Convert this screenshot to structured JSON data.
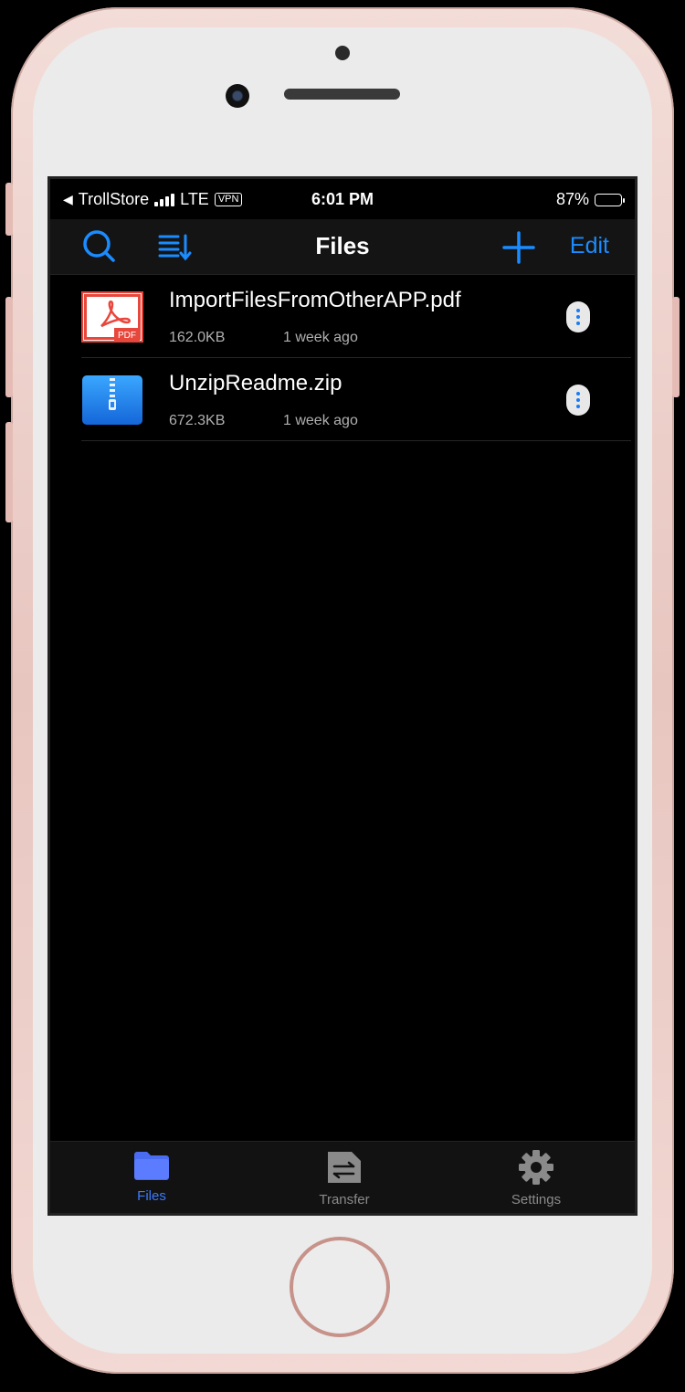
{
  "status_bar": {
    "back_app": "TrollStore",
    "network": "LTE",
    "vpn": "VPN",
    "time": "6:01 PM",
    "battery_percent": "87%",
    "battery_level": 0.87
  },
  "nav": {
    "title": "Files",
    "edit_label": "Edit",
    "icons": [
      "search-icon",
      "sort-icon",
      "plus-icon"
    ],
    "accent_color": "#1a8cff"
  },
  "files": [
    {
      "name": "ImportFilesFromOtherAPP.pdf",
      "size": "162.0KB",
      "modified": "1 week ago",
      "icon": "pdf-icon",
      "badge": "PDF"
    },
    {
      "name": "UnzipReadme.zip",
      "size": "672.3KB",
      "modified": "1 week ago",
      "icon": "zip-icon"
    }
  ],
  "tabs": [
    {
      "label": "Files",
      "icon": "folder-icon",
      "active": true
    },
    {
      "label": "Transfer",
      "icon": "transfer-icon",
      "active": false
    },
    {
      "label": "Settings",
      "icon": "gear-icon",
      "active": false
    }
  ]
}
